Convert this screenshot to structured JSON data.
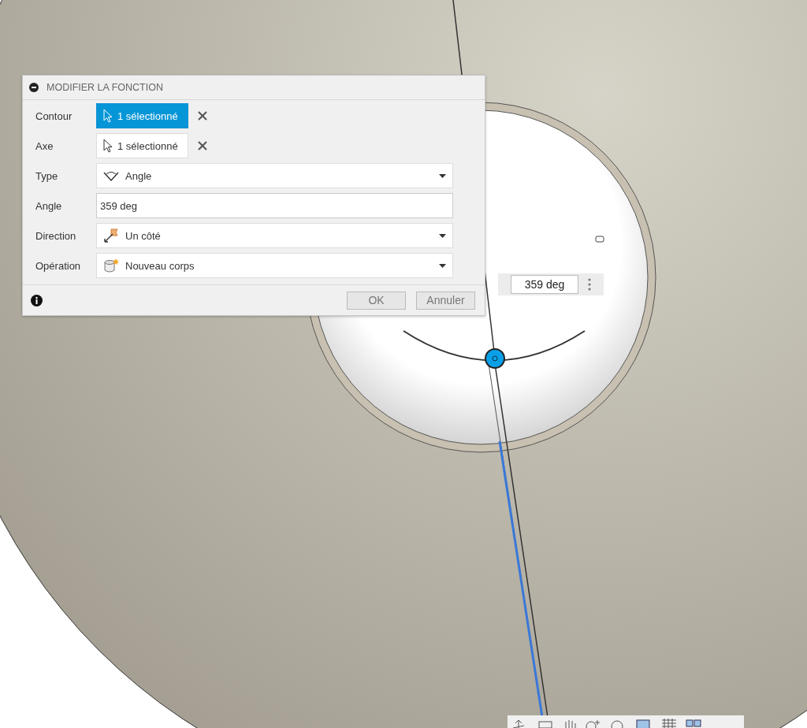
{
  "dialog": {
    "title": "MODIFIER LA FONCTION",
    "expanded": true,
    "rows": [
      {
        "kind": "selection",
        "label": "Contour",
        "value": "1 sélectionné",
        "selected": true
      },
      {
        "kind": "selection",
        "label": "Axe",
        "value": "1 sélectionné",
        "selected": false
      },
      {
        "kind": "dropdown",
        "label": "Type",
        "value": "Angle"
      },
      {
        "kind": "input",
        "label": "Angle",
        "value": "359 deg"
      },
      {
        "kind": "dropdown",
        "label": "Direction",
        "value": "Un côté"
      },
      {
        "kind": "dropdown",
        "label": "Opération",
        "value": "Nouveau corps"
      }
    ],
    "buttons": [
      "OK",
      "Annuler"
    ]
  },
  "manipulator": {
    "value": "359 deg"
  }
}
